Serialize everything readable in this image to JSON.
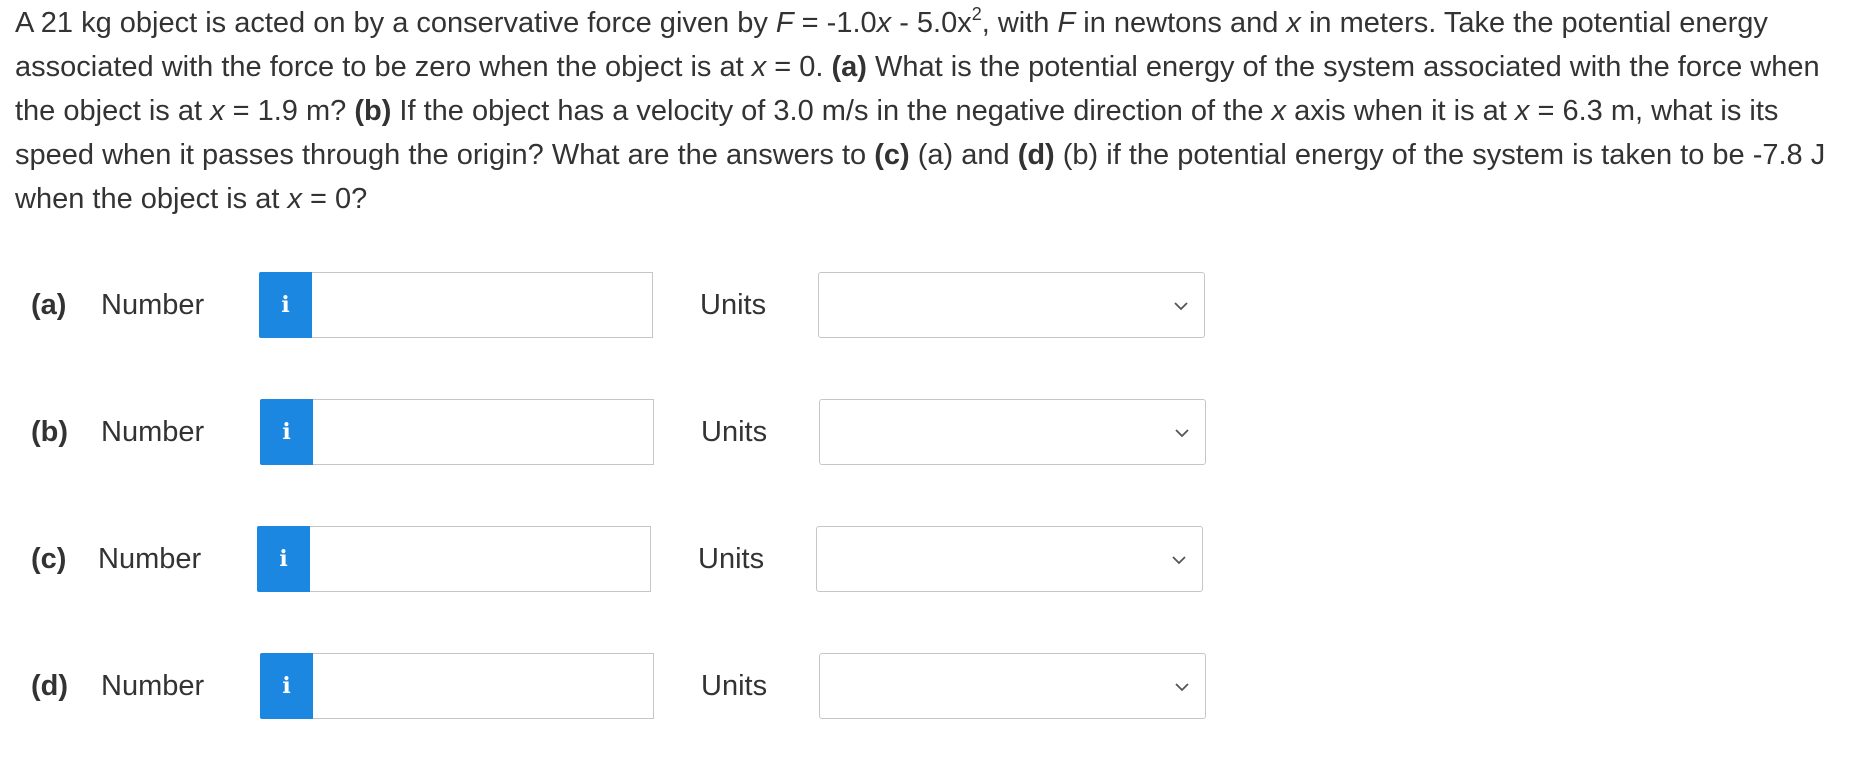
{
  "question": {
    "t1": "A 21 kg object is acted on by a conservative force given by ",
    "F1": "F",
    "t2": " = -1.0",
    "x1": "x",
    "t3": " - 5.0x",
    "exp": "2",
    "t4": ", with ",
    "F2": "F",
    "t5": " in newtons and ",
    "x2": "x",
    "t6": " in meters. Take the potential energy associated with the force to be zero when the object is at ",
    "x3": "x",
    "t7": " = 0. ",
    "a_tag": "(a)",
    "t8": " What is the potential energy of the system associated with the force when the object is at ",
    "x4": "x",
    "t9": " = 1.9 m? ",
    "b_tag": "(b)",
    "t10": " If the object has a velocity of 3.0 m/s in the negative direction of the ",
    "x5": "x",
    "t11": " axis when it is at ",
    "x6": "x",
    "t12": " = 6.3 m, what is its speed when it passes through the origin? What are the answers to ",
    "c_tag": "(c)",
    "t13": " (a) and ",
    "d_tag": "(d)",
    "t14": " (b) if the potential energy of the system is taken to be -7.8 J when the object is at ",
    "x7": "x",
    "t15": " = 0?"
  },
  "parts": [
    {
      "label": "(a)",
      "number_label": "Number",
      "info_icon": "i",
      "number_value": "",
      "units_label": "Units",
      "units_value": ""
    },
    {
      "label": "(b)",
      "number_label": "Number",
      "info_icon": "i",
      "number_value": "",
      "units_label": "Units",
      "units_value": ""
    },
    {
      "label": "(c)",
      "number_label": "Number",
      "info_icon": "i",
      "number_value": "",
      "units_label": "Units",
      "units_value": ""
    },
    {
      "label": "(d)",
      "number_label": "Number",
      "info_icon": "i",
      "number_value": "",
      "units_label": "Units",
      "units_value": ""
    }
  ],
  "colors": {
    "info_button": "#1b87e0",
    "text": "#333333",
    "border": "#c6c6c6"
  }
}
